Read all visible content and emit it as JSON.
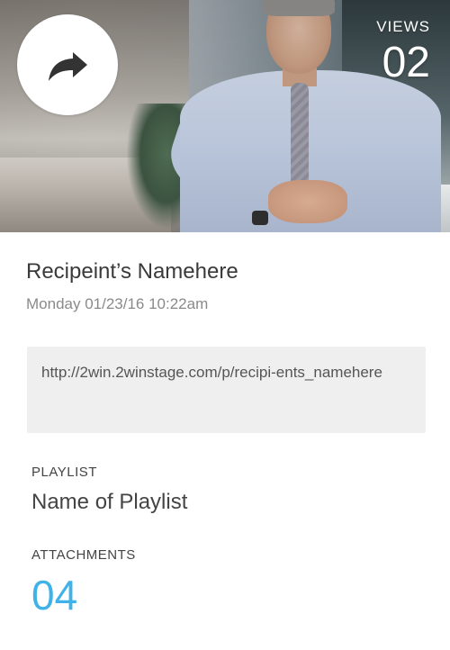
{
  "hero": {
    "share_icon": "share-arrow-icon",
    "views_label": "VIEWS",
    "views_value": "02"
  },
  "recipient": {
    "name": "Recipeint’s Namehere",
    "datetime": "Monday 01/23/16 10:22am",
    "url": "http://2win.2winstage.com/p/recipi-ents_namehere"
  },
  "playlist": {
    "label": "PLAYLIST",
    "name": "Name of Playlist"
  },
  "attachments": {
    "label": "ATTACHMENTS",
    "count": "04"
  },
  "colors": {
    "accent": "#3fb2e8",
    "text": "#3a3a3a",
    "muted": "#8a8a8a",
    "url_bg": "#efefef"
  }
}
